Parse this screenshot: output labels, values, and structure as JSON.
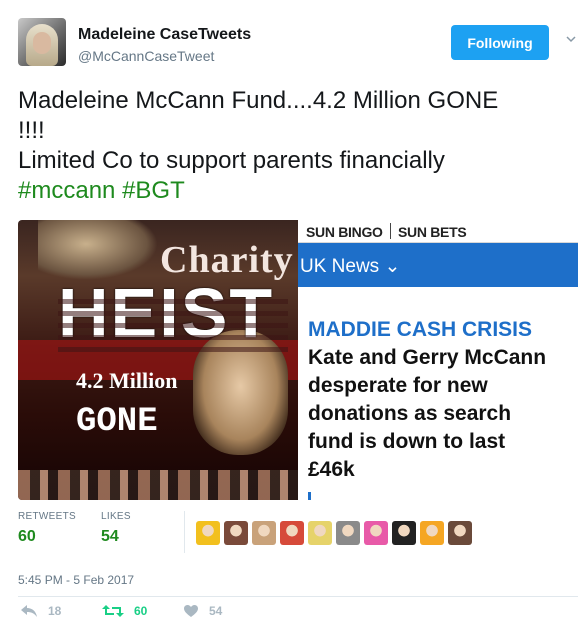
{
  "author": {
    "name": "Madeleine CaseTweets",
    "handle": "@McCannCaseTweet",
    "avatar_icon": "profile-photo"
  },
  "follow_button": {
    "label": "Following",
    "color": "#1da1f2"
  },
  "menu_icon": "chevron-down-icon",
  "tweet": {
    "line1": "Madeleine McCann Fund....4.2 Million GONE",
    "line2": "!!!!",
    "line3": "Limited Co to support parents financially",
    "hashtags": [
      "#mccann",
      "#BGT"
    ],
    "hashtag_color": "#1e8a1e"
  },
  "media": {
    "poster": {
      "title_top": "Charity",
      "title_main": "HEIST",
      "amount": "4.2 Million",
      "word": "GONE"
    },
    "article": {
      "nav_left": "SUN BINGO",
      "nav_right": "SUN BETS",
      "section": "UK News ⌄",
      "kicker": "MADDIE CASH CRISIS",
      "headline_lines": [
        "Kate and Gerry McCann",
        "desperate for new",
        "donations as search",
        "fund is down to last",
        "£46k"
      ],
      "accent_color": "#1e6fc9"
    }
  },
  "stats": {
    "retweets_label": "RETWEETS",
    "retweets_count": "60",
    "likes_label": "LIKES",
    "likes_count": "54",
    "count_color": "#1e8a1e"
  },
  "likers": [
    {
      "icon": "pirate-duck-avatar",
      "color": "#f2c01e"
    },
    {
      "icon": "user-avatar",
      "color": "#7a4a3a"
    },
    {
      "icon": "user-avatar",
      "color": "#c9a27a"
    },
    {
      "icon": "user-avatar",
      "color": "#d64a3a"
    },
    {
      "icon": "user-avatar",
      "color": "#e6d36a"
    },
    {
      "icon": "user-avatar",
      "color": "#8a8a8a"
    },
    {
      "icon": "dancer-avatar",
      "color": "#e85aa8"
    },
    {
      "icon": "text-avatar",
      "color": "#222222"
    },
    {
      "icon": "egg-avatar",
      "color": "#f5a623"
    },
    {
      "icon": "user-avatar",
      "color": "#6a4a3a"
    }
  ],
  "timestamp": "5:45 PM - 5 Feb 2017",
  "actions": {
    "reply_count": "18",
    "retweet_count": "60",
    "like_count": "54",
    "reply_color": "#aab8c2",
    "retweet_color": "#19cf86",
    "like_color": "#aab8c2"
  }
}
